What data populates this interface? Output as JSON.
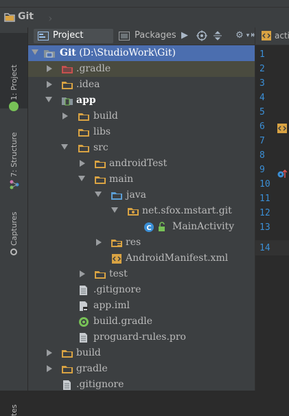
{
  "breadcrumb": {
    "label": "Git"
  },
  "left_tabs": {
    "project": "1: Project",
    "structure": "7: Structure",
    "captures": "Captures",
    "bottom": "tes"
  },
  "toolbar": {
    "project_tab": "Project",
    "packages_tab": "Packages"
  },
  "tree": {
    "root_name": "Git",
    "root_path": "(D:\\StudioWork\\Git)",
    "gradle_dir": ".gradle",
    "idea_dir": ".idea",
    "app": "app",
    "build": "build",
    "libs": "libs",
    "src": "src",
    "androidTest": "androidTest",
    "main": "main",
    "java": "java",
    "package": "net.sfox.mstart.git",
    "main_activity": "MainActivity",
    "res": "res",
    "manifest": "AndroidManifest.xml",
    "test": "test",
    "app_gitignore": ".gitignore",
    "app_iml": "app.iml",
    "build_gradle": "build.gradle",
    "proguard": "proguard-rules.pro",
    "root_build": "build",
    "root_gradle": "gradle",
    "root_gitignore": ".gitignore"
  },
  "editor": {
    "tab_label": "acti",
    "line_numbers": [
      "1",
      "2",
      "3",
      "4",
      "5",
      "6",
      "7",
      "8",
      "9",
      "10",
      "11",
      "12",
      "13",
      "14"
    ]
  },
  "colors": {
    "selection": "#4b6eaf",
    "line_number": "#3b8fd6",
    "panel": "#3c3f41",
    "editor": "#2b2b2b",
    "folder": "#e0b25c"
  }
}
